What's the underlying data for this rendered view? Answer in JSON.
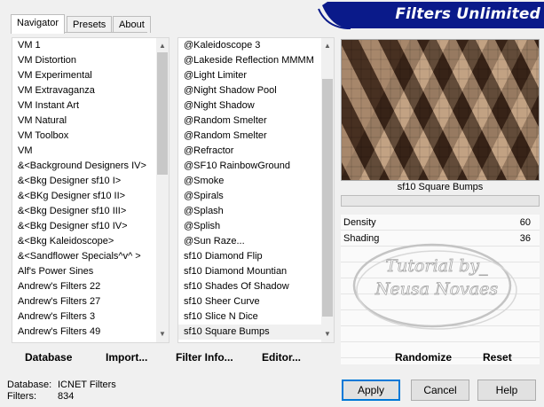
{
  "header": {
    "brand_title": "Filters Unlimited"
  },
  "tabs": [
    {
      "label": "Navigator",
      "active": true
    },
    {
      "label": "Presets",
      "active": false
    },
    {
      "label": "About",
      "active": false
    }
  ],
  "category_list": {
    "items": [
      "VM 1",
      "VM Distortion",
      "VM Experimental",
      "VM Extravaganza",
      "VM Instant Art",
      "VM Natural",
      "VM Toolbox",
      "VM",
      "&<Background Designers IV>",
      "&<Bkg Designer sf10 I>",
      "&<BKg Designer sf10 II>",
      "&<Bkg Designer sf10 III>",
      "&<Bkg Designer sf10 IV>",
      "&<Bkg Kaleidoscope>",
      "&<Sandflower Specials^v^ >",
      "Alf's Power Sines",
      "Andrew's Filters 22",
      "Andrew's Filters 27",
      "Andrew's Filters 3",
      "Andrew's Filters 49"
    ]
  },
  "filter_list": {
    "items": [
      "@Kaleidoscope 3",
      "@Lakeside Reflection MMMM",
      "@Light Limiter",
      "@Night Shadow Pool",
      "@Night Shadow",
      "@Random Smelter",
      "@Random Smelter",
      "@Refractor",
      "@SF10 RainbowGround",
      "@Smoke",
      "@Spirals",
      "@Splash",
      "@Splish",
      "@Sun Raze...",
      "sf10 Diamond Flip",
      "sf10 Diamond Mountian",
      "sf10 Shades Of Shadow",
      "sf10 Sheer Curve",
      "sf10 Slice N Dice",
      "sf10 Square Bumps"
    ],
    "selected": "sf10 Square Bumps"
  },
  "preview": {
    "filter_name": "sf10 Square Bumps",
    "watermark_line1": "Tutorial by_",
    "watermark_line2": "Neusa Novaes"
  },
  "parameters": [
    {
      "label": "Density",
      "value": "60"
    },
    {
      "label": "Shading",
      "value": "36"
    }
  ],
  "toolbar": {
    "database": "Database",
    "import": "Import...",
    "filter_info": "Filter Info...",
    "editor": "Editor...",
    "randomize": "Randomize",
    "reset": "Reset"
  },
  "status": {
    "database_label": "Database:",
    "database_value": "ICNET Filters",
    "filters_label": "Filters:",
    "filters_value": "834"
  },
  "buttons": {
    "apply": "Apply",
    "cancel": "Cancel",
    "help": "Help"
  },
  "colors": {
    "banner_blue": "#0a1a8a",
    "preview_dark": "#2a1a10",
    "preview_light": "#d8b898",
    "default_button_border": "#0078d7"
  }
}
